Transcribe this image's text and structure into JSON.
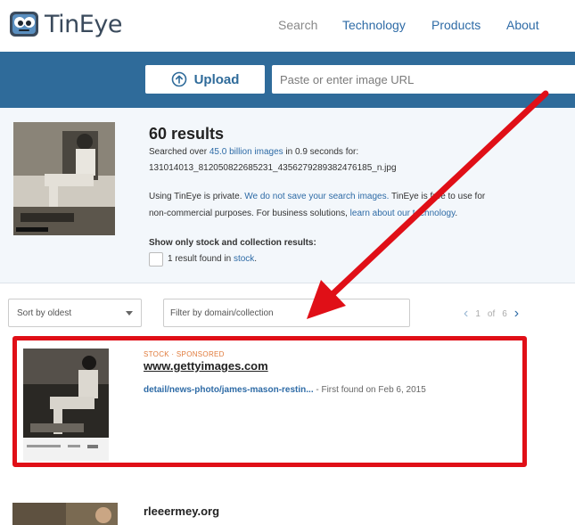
{
  "brand": {
    "name": "TinEye"
  },
  "nav": {
    "search": "Search",
    "technology": "Technology",
    "products": "Products",
    "about": "About"
  },
  "upload": {
    "button_label": "Upload",
    "url_placeholder": "Paste or enter image URL"
  },
  "summary": {
    "count": "60 results",
    "searched_prefix": "Searched over ",
    "searched_link": "45.0 billion images",
    "searched_suffix": " in 0.9 seconds for:",
    "filename": "131014013_812050822685231_4356279289382476185_n.jpg",
    "privacy_prefix": "Using TinEye is private. ",
    "privacy_link": "We do not save your search images.",
    "privacy_suffix": " TinEye is free to use for",
    "privacy_line2_prefix": "non-commercial purposes. For business solutions, ",
    "privacy_line2_link": "learn about our technology",
    "privacy_line2_suffix": ".",
    "stock_title": "Show only stock and collection results:",
    "stock_prefix": "1 result found in ",
    "stock_link": "stock",
    "stock_suffix": "."
  },
  "filters": {
    "sort_label": "Sort by oldest",
    "domain_placeholder": "Filter by domain/collection",
    "page_current": "1",
    "page_of": "of",
    "page_total": "6"
  },
  "results": [
    {
      "tag": "STOCK · SPONSORED",
      "domain": "www.gettyimages.com",
      "path": "detail/news-photo/james-mason-restin...",
      "found": " - First found on Feb 6, 2015"
    },
    {
      "domain": "rleeermey.org"
    }
  ],
  "colors": {
    "accent": "#2f6b9a",
    "link": "#2e6ba6",
    "highlight": "#e00f17",
    "sponsored": "#e07a3a"
  }
}
